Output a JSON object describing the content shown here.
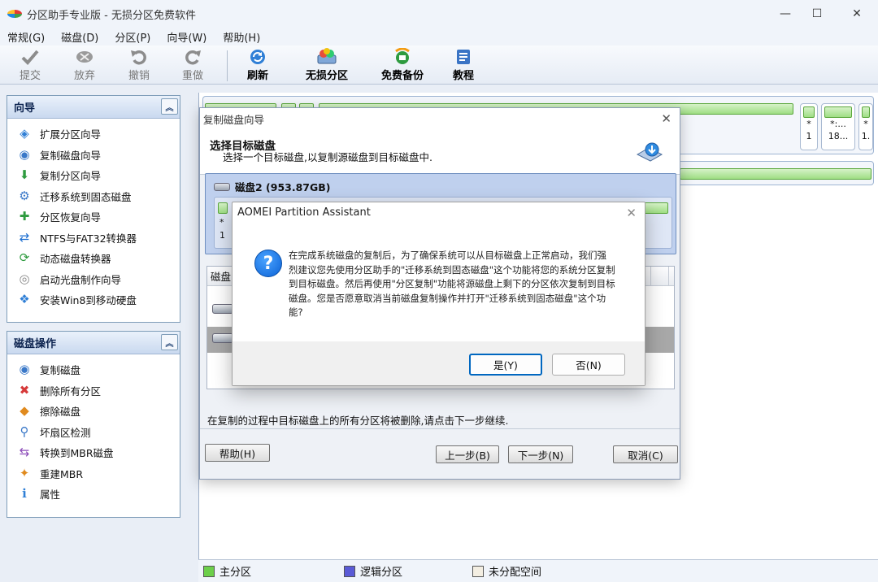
{
  "window": {
    "title": "分区助手专业版 - 无损分区免费软件",
    "minimize_glyph": "—",
    "maximize_glyph": "☐",
    "close_glyph": "✕"
  },
  "menu": [
    "常规(G)",
    "磁盘(D)",
    "分区(P)",
    "向导(W)",
    "帮助(H)"
  ],
  "toolbar": {
    "commit": "提交",
    "discard": "放弃",
    "undo": "撤销",
    "redo": "重做",
    "refresh": "刷新",
    "lossless": "无损分区",
    "free_backup": "免费备份",
    "tutorial": "教程"
  },
  "wizard_panel": {
    "title": "向导",
    "collapse_glyph": "︽",
    "items": [
      {
        "label": "扩展分区向导",
        "icon": "extend-partition-icon"
      },
      {
        "label": "复制磁盘向导",
        "icon": "copy-disk-icon"
      },
      {
        "label": "复制分区向导",
        "icon": "copy-partition-icon"
      },
      {
        "label": "迁移系统到固态磁盘",
        "icon": "migrate-ssd-icon"
      },
      {
        "label": "分区恢复向导",
        "icon": "partition-recovery-icon"
      },
      {
        "label": "NTFS与FAT32转换器",
        "icon": "ntfs-fat32-icon"
      },
      {
        "label": "动态磁盘转换器",
        "icon": "dynamic-disk-icon"
      },
      {
        "label": "启动光盘制作向导",
        "icon": "boot-cd-icon"
      },
      {
        "label": "安装Win8到移动硬盘",
        "icon": "win8-usb-icon"
      }
    ]
  },
  "disk_panel": {
    "title": "磁盘操作",
    "collapse_glyph": "︽",
    "items": [
      {
        "label": "复制磁盘",
        "icon": "copy-disk-icon"
      },
      {
        "label": "删除所有分区",
        "icon": "delete-partitions-icon"
      },
      {
        "label": "擦除磁盘",
        "icon": "wipe-disk-icon"
      },
      {
        "label": "坏扇区检测",
        "icon": "bad-sector-icon"
      },
      {
        "label": "转换到MBR磁盘",
        "icon": "convert-mbr-icon"
      },
      {
        "label": "重建MBR",
        "icon": "rebuild-mbr-icon"
      },
      {
        "label": "属性",
        "icon": "properties-icon"
      }
    ]
  },
  "disk_map": {
    "right_parts": [
      {
        "top": "*",
        "bottom": "1"
      },
      {
        "top": "*:...",
        "bottom": "18..."
      },
      {
        "top": "*",
        "bottom": "1."
      }
    ]
  },
  "wizard_dialog": {
    "title": "复制磁盘向导",
    "close_glyph": "✕",
    "header_title": "选择目标磁盘",
    "header_sub": "选择一个目标磁盘,以复制源磁盘到目标磁盘中.",
    "disk_label": "磁盘2 (953.87GB)",
    "inner_star": "*",
    "inner_num": "1",
    "list_header_first": "磁盘",
    "note": "在复制的过程中目标磁盘上的所有分区将被删除,请点击下一步继续.",
    "help": "帮助(H)",
    "back": "上一步(B)",
    "next": "下一步(N)",
    "cancel": "取消(C)"
  },
  "message_box": {
    "title": "AOMEI Partition Assistant",
    "close_glyph": "✕",
    "icon_glyph": "?",
    "text": "在完成系统磁盘的复制后，为了确保系统可以从目标磁盘上正常启动，我们强烈建议您先使用分区助手的\"迁移系统到固态磁盘\"这个功能将您的系统分区复制到目标磁盘。然后再使用\"分区复制\"功能将源磁盘上剩下的分区依次复制到目标磁盘。您是否愿意取消当前磁盘复制操作并打开\"迁移系统到固态磁盘\"这个功能?",
    "yes": "是(Y)",
    "no": "否(N)"
  },
  "statusbar": {
    "primary": "主分区",
    "logical": "逻辑分区",
    "unallocated": "未分配空间",
    "colors": {
      "primary": "#6ccf4a",
      "logical": "#5a5ad6",
      "unallocated": "#f3eee2"
    }
  }
}
